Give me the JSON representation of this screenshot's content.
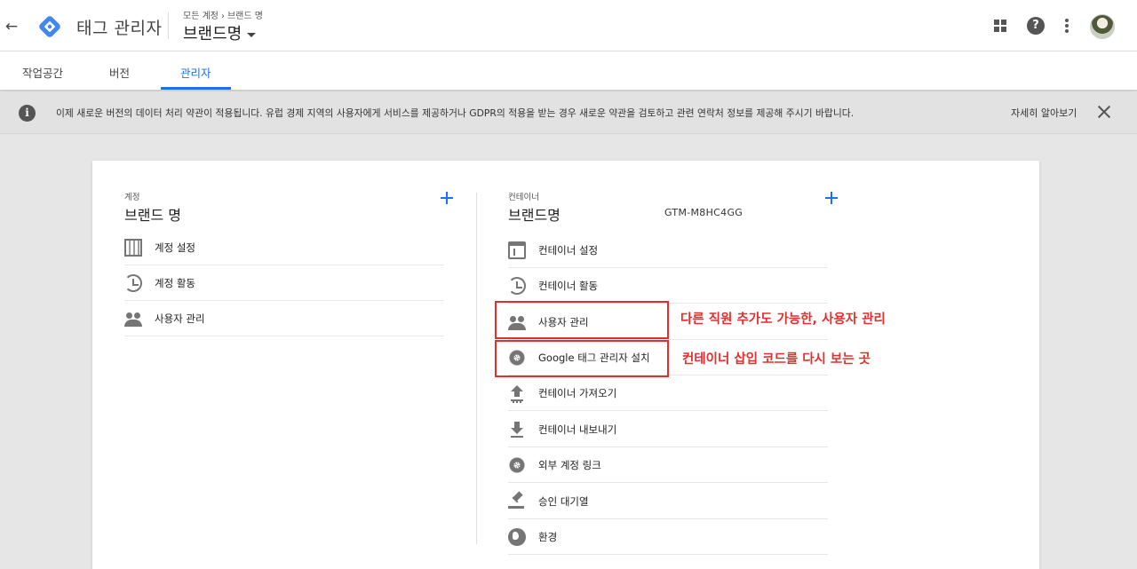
{
  "header": {
    "product_name": "태그 관리자",
    "breadcrumb": {
      "root": "모든 계정",
      "separator": "›",
      "current": "브랜드 명"
    },
    "account_name": "브랜드명"
  },
  "tabs": [
    {
      "label": "작업공간"
    },
    {
      "label": "버전"
    },
    {
      "label": "관리자",
      "active": true
    }
  ],
  "notice": {
    "text": "이제 새로운 버전의 데이터 처리 약관이 적용됩니다. 유럽 경제 지역의 사용자에게 서비스를 제공하거나 GDPR의 적용을 받는 경우 새로운 약관을 검토하고 관련 연락처 정보를 제공해 주시기 바랍니다.",
    "link": "자세히 알아보기"
  },
  "account_column": {
    "label": "계정",
    "title": "브랜드 명",
    "items": [
      {
        "label": "계정 설정",
        "icon": "building-icon"
      },
      {
        "label": "계정 활동",
        "icon": "history-icon"
      },
      {
        "label": "사용자 관리",
        "icon": "people-icon"
      }
    ]
  },
  "container_column": {
    "label": "컨테이너",
    "title": "브랜드명",
    "container_id": "GTM-M8HC4GG",
    "items": [
      {
        "label": "컨테이너 설정",
        "icon": "web-icon"
      },
      {
        "label": "컨테이너 활동",
        "icon": "history-icon"
      },
      {
        "label": "사용자 관리",
        "icon": "people-icon"
      },
      {
        "label": "Google 태그 관리자 설치",
        "icon": "gear-icon"
      },
      {
        "label": "컨테이너 가져오기",
        "icon": "upload-icon"
      },
      {
        "label": "컨테이너 내보내기",
        "icon": "download-icon"
      },
      {
        "label": "외부 계정 링크",
        "icon": "gear-icon"
      },
      {
        "label": "승인 대기열",
        "icon": "gavel-icon"
      },
      {
        "label": "환경",
        "icon": "globe-icon"
      }
    ]
  },
  "annotations": [
    {
      "text": "다른 직원 추가도 가능한, 사용자 관리"
    },
    {
      "text": "컨테이너 삽입 코드를 다시 보는 곳"
    }
  ],
  "colors": {
    "accent": "#1a73e8",
    "annotation": "#e02f2f",
    "gtm_logo": "#4285f4"
  }
}
